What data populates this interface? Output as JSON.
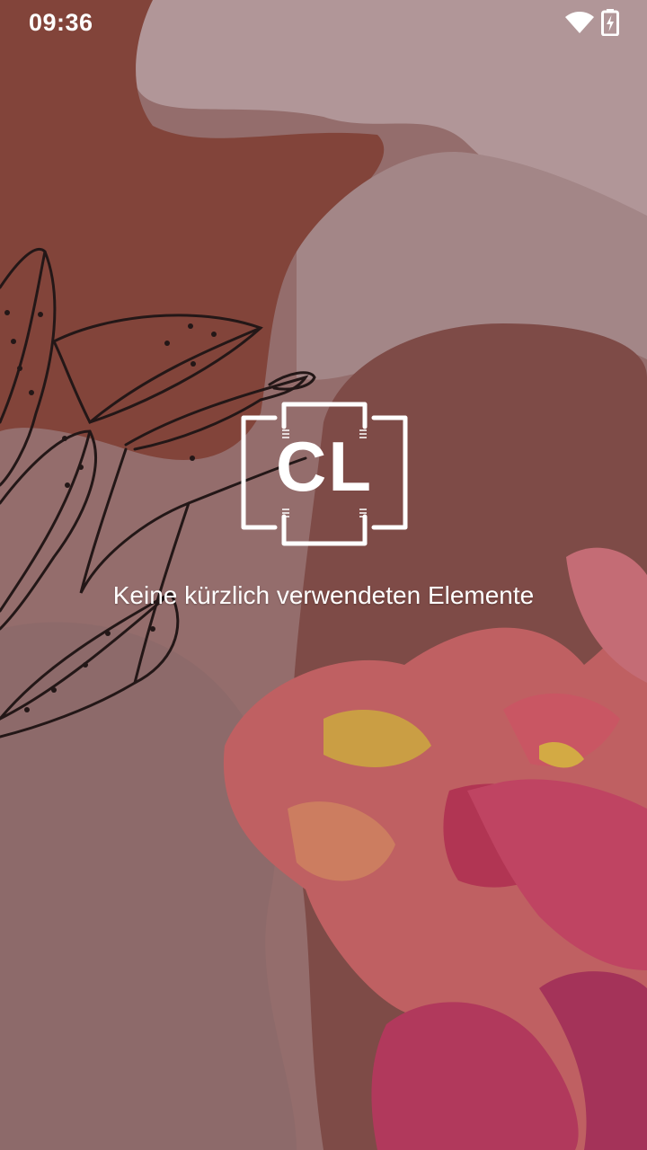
{
  "status_bar": {
    "time": "09:36",
    "wifi_icon": "wifi-icon",
    "battery_icon": "battery-charging-icon"
  },
  "wallpaper": {
    "description_icon": "floral-wallpaper",
    "colors": {
      "rust": "#8f4a3e",
      "mauve": "#a47b78",
      "pale": "#c5a9a9",
      "flower_pink": "#e0607a",
      "flower_coral": "#e07a60",
      "flower_yellow": "#e8c24a"
    }
  },
  "launcher": {
    "logo_text": "CL",
    "empty_message": "Keine kürzlich verwendeten Elemente"
  }
}
